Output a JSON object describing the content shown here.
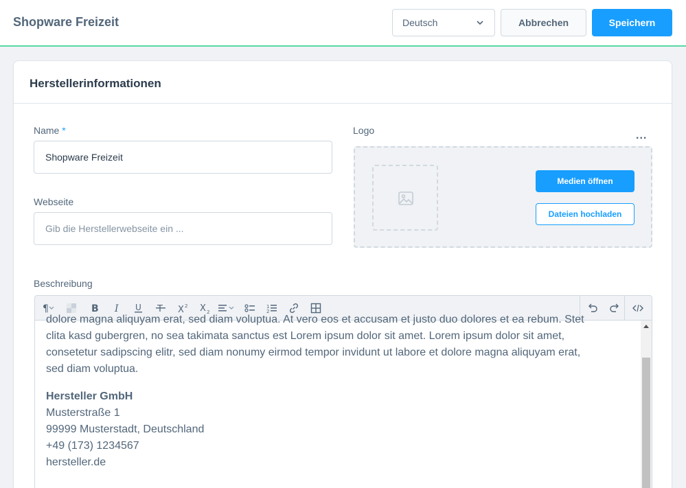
{
  "header": {
    "title": "Shopware Freizeit",
    "language": "Deutsch",
    "cancel_label": "Abbrechen",
    "save_label": "Speichern"
  },
  "card": {
    "title": "Herstellerinformationen",
    "name_label": "Name",
    "name_required_mark": "*",
    "name_value": "Shopware Freizeit",
    "website_label": "Webseite",
    "website_placeholder": "Gib die Herstellerwebseite ein ...",
    "logo_label": "Logo",
    "more_label": "...",
    "media_button": "Medien öffnen",
    "upload_button": "Dateien hochladen",
    "description_label": "Beschreibung"
  },
  "editor": {
    "toolbar_icons": [
      "paragraph-format-icon",
      "text-color-icon",
      "bold-icon",
      "italic-icon",
      "underline-icon",
      "strikethrough-icon",
      "superscript-icon",
      "subscript-icon",
      "align-icon",
      "bullet-list-icon",
      "numbered-list-icon",
      "link-icon",
      "table-icon",
      "undo-icon",
      "redo-icon",
      "code-view-icon"
    ],
    "paragraph_lines": [
      "dolore magna aliquyam erat, sed diam voluptua. At vero eos et accusam et justo duo dolores et ea rebum. Stet",
      "clita kasd gubergren, no sea takimata sanctus est Lorem ipsum dolor sit amet. Lorem ipsum dolor sit amet,",
      "consetetur sadipscing elitr, sed diam nonumy eirmod tempor invidunt ut labore et dolore magna aliquyam erat,",
      "sed diam voluptua."
    ],
    "address": {
      "company": "Hersteller GmbH",
      "street": "Musterstraße 1",
      "city": "99999 Musterstadt, Deutschland",
      "phone": "+49 (173) 1234567",
      "website": "hersteller.de"
    }
  },
  "colors": {
    "accent": "#189eff",
    "header_border": "#57d9a3",
    "text": "#52667a"
  }
}
